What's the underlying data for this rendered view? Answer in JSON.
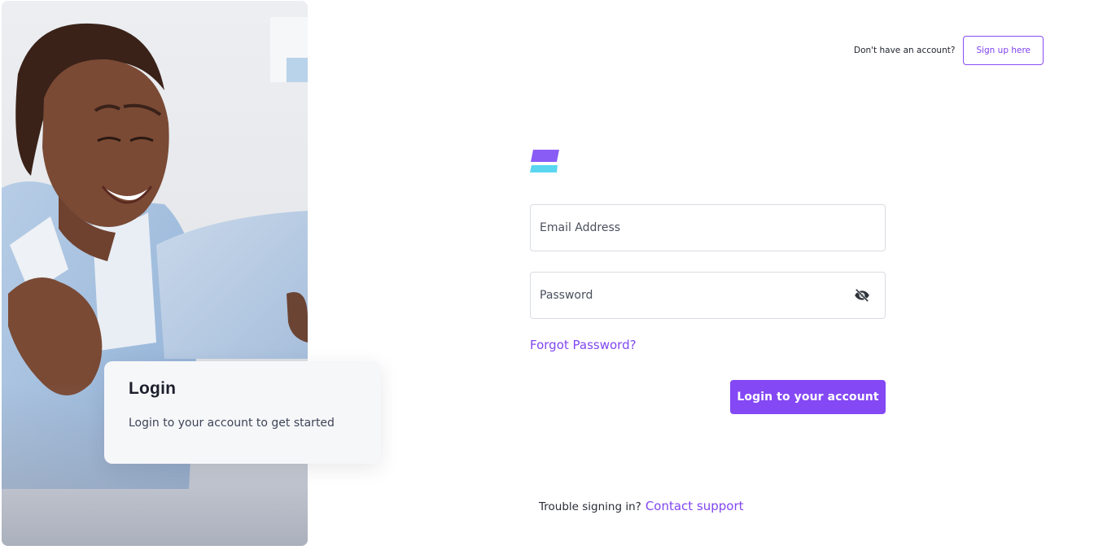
{
  "hero": {
    "card_title": "Login",
    "card_subtitle": "Login to your account to get started"
  },
  "header": {
    "signup_prompt": "Don't have an account?",
    "signup_label": "Sign up here"
  },
  "form": {
    "email_placeholder": "Email Address",
    "email_value": "",
    "password_placeholder": "Password",
    "password_value": "",
    "password_toggle_icon": "eye-off-icon",
    "forgot_label": "Forgot Password?",
    "submit_label": "Login to your account"
  },
  "footer": {
    "trouble_text": "Trouble signing in?",
    "contact_label": "Contact support"
  },
  "colors": {
    "accent": "#8448f5",
    "logo_top": "#8a5cf6",
    "logo_bottom": "#5ad6f0"
  }
}
